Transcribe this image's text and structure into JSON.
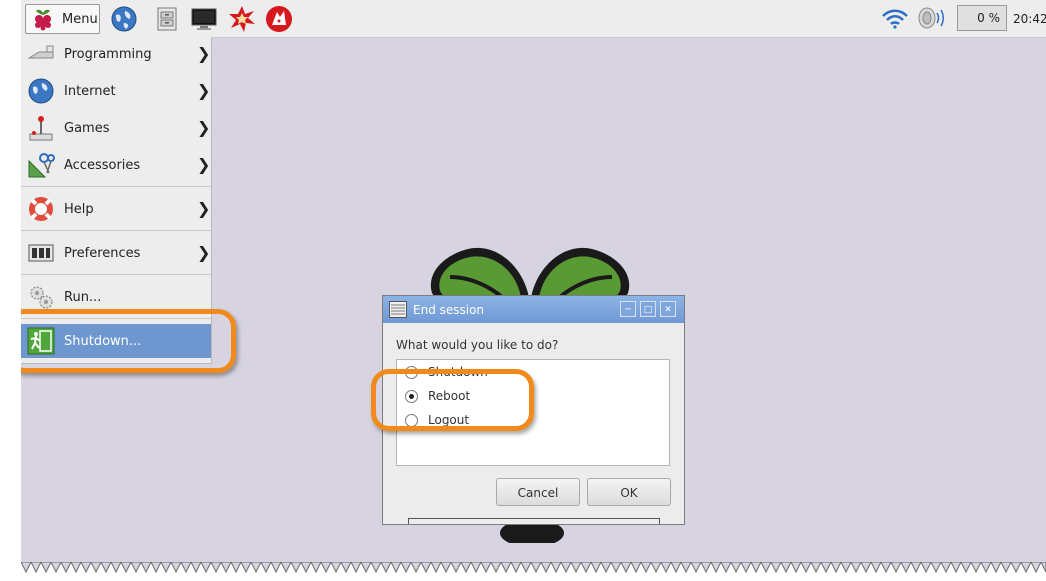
{
  "panel": {
    "menu_label": "Menu",
    "launchers": [
      "web-browser-icon",
      "file-manager-icon",
      "terminal-icon",
      "mathematica-icon",
      "wolfram-icon"
    ],
    "status_icons": [
      "wifi-icon",
      "volume-icon"
    ],
    "cpu_usage": "0 %",
    "clock": "20:42"
  },
  "app_menu": {
    "items": [
      {
        "label": "Programming",
        "icon": "programming-icon",
        "submenu": true
      },
      {
        "label": "Internet",
        "icon": "internet-icon",
        "submenu": true
      },
      {
        "label": "Games",
        "icon": "games-icon",
        "submenu": true
      },
      {
        "label": "Accessories",
        "icon": "accessories-icon",
        "submenu": true
      },
      {
        "label": "Help",
        "icon": "help-icon",
        "submenu": true
      },
      {
        "label": "Preferences",
        "icon": "preferences-icon",
        "submenu": true
      },
      {
        "label": "Run...",
        "icon": "run-icon",
        "submenu": false
      },
      {
        "label": "Shutdown...",
        "icon": "shutdown-icon",
        "submenu": false,
        "selected": true
      }
    ]
  },
  "dialog": {
    "title": "End session",
    "prompt": "What would you like to do?",
    "options": [
      {
        "label": "Shutdown",
        "checked": false
      },
      {
        "label": "Reboot",
        "checked": true
      },
      {
        "label": "Logout",
        "checked": false
      }
    ],
    "cancel_label": "Cancel",
    "ok_label": "OK",
    "window_buttons": [
      "minimize-icon",
      "maximize-icon",
      "close-icon"
    ]
  },
  "colors": {
    "desktop": "#d7d3e0",
    "panel": "#ededed",
    "selection": "#6f97cf",
    "titlebar": "#7ba3db",
    "annotation": "#f08a1c"
  }
}
